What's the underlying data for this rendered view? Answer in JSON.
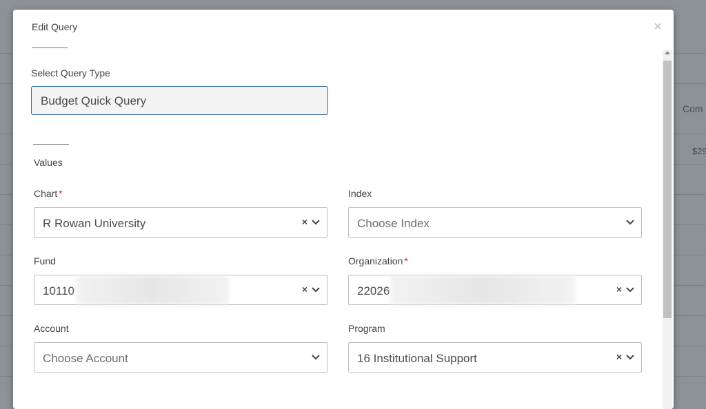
{
  "background": {
    "column_header": "Com",
    "cell_value": "$29"
  },
  "modal": {
    "title": "Edit Query",
    "close_label": "×",
    "query_type_label": "Select Query Type",
    "query_type_value": "Budget Quick Query",
    "values_label": "Values",
    "required_marker": "*",
    "fields": {
      "chart": {
        "label": "Chart",
        "value": "R Rowan University"
      },
      "index": {
        "label": "Index",
        "placeholder": "Choose Index"
      },
      "fund": {
        "label": "Fund",
        "value": "10110"
      },
      "organization": {
        "label": "Organization",
        "value": "22026"
      },
      "account": {
        "label": "Account",
        "placeholder": "Choose Account"
      },
      "program": {
        "label": "Program",
        "value": "16 Institutional Support"
      }
    },
    "clear_symbol": "×"
  },
  "colors": {
    "accent_border": "#2f6c9e",
    "required": "#d0202a"
  }
}
